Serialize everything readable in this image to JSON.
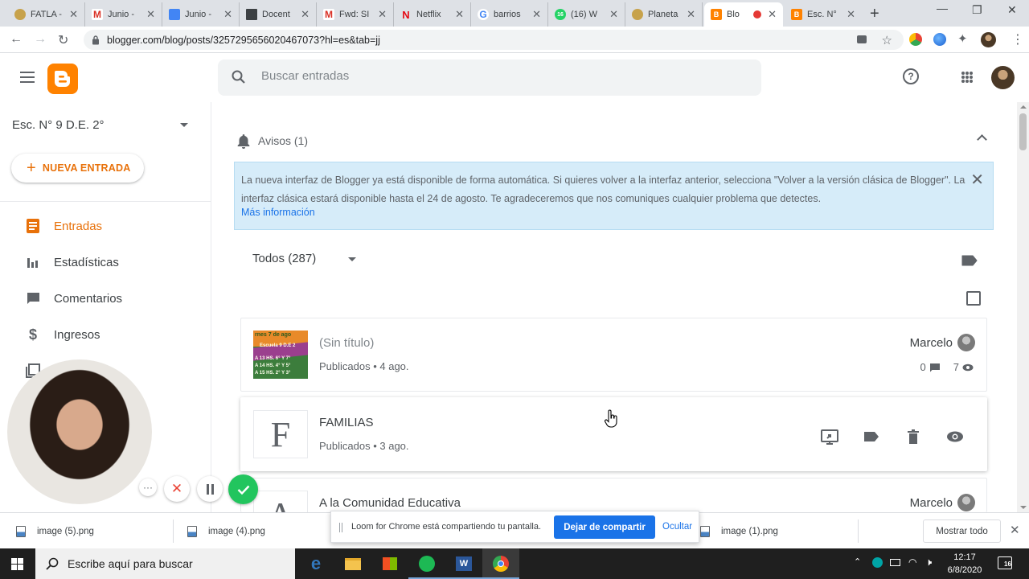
{
  "browser": {
    "tabs": [
      {
        "title": "FATLA -",
        "favicon": "fatla"
      },
      {
        "title": "Junio -",
        "favicon": "gmail"
      },
      {
        "title": "Junio -",
        "favicon": "docs"
      },
      {
        "title": "Docent",
        "favicon": "classroom"
      },
      {
        "title": "Fwd: SI",
        "favicon": "gmail"
      },
      {
        "title": "Netflix",
        "favicon": "netflix"
      },
      {
        "title": "barrios",
        "favicon": "google"
      },
      {
        "title": "(16) W",
        "favicon": "whatsapp"
      },
      {
        "title": "Planeta",
        "favicon": "fatla"
      },
      {
        "title": "Blo",
        "favicon": "blogger"
      },
      {
        "title": "Esc. N°",
        "favicon": "blogger"
      }
    ],
    "url": "blogger.com/blog/posts/3257295656020467073?hl=es&tab=jj"
  },
  "header": {
    "search_placeholder": "Buscar entradas"
  },
  "sidebar": {
    "blog_name": "Esc. N° 9 D.E. 2°",
    "new_post_label": "NUEVA ENTRADA",
    "items": [
      {
        "label": "Entradas",
        "icon": "posts-icon"
      },
      {
        "label": "Estadísticas",
        "icon": "stats-icon"
      },
      {
        "label": "Comentarios",
        "icon": "comments-icon"
      },
      {
        "label": "Ingresos",
        "icon": "earnings-icon"
      }
    ]
  },
  "notices": {
    "heading": "Avisos (1)",
    "message": "La nueva interfaz de Blogger ya está disponible de forma automática. Si quieres volver a la interfaz anterior, selecciona \"Volver a la versión clásica de Blogger\". La interfaz clásica estará disponible hasta el 24 de agosto. Te agradeceremos que nos comuniques cualquier problema que detectes.",
    "link": "Más información"
  },
  "posts": {
    "filter_label": "Todos (287)",
    "items": [
      {
        "title": "(Sin título)",
        "status": "Publicados • 4 ago.",
        "author": "Marcelo",
        "comments": "0",
        "views": "7",
        "thumb_text": [
          "rnes 7 de ago",
          "Escuela 9 D.E 2",
          "A 13 HS.  6° Y 7°",
          "A 14 HS.  4° Y 5°",
          "A 15 HS.  2° Y 3°"
        ]
      },
      {
        "title": "FAMILIAS",
        "status": "Publicados • 3 ago.",
        "letter": "F"
      },
      {
        "title": "A la Comunidad Educativa",
        "author": "Marcelo",
        "letter": "A"
      }
    ]
  },
  "loom": {
    "message": "Loom for Chrome está compartiendo tu pantalla.",
    "stop_label": "Dejar de compartir",
    "hide_label": "Ocultar"
  },
  "downloads": {
    "files": [
      "image (5).png",
      "image (4).png",
      "image (1).png"
    ],
    "show_all": "Mostrar todo"
  },
  "taskbar": {
    "search_placeholder": "Escribe aquí para buscar",
    "time": "12:17",
    "date": "6/8/2020",
    "notifications": "16"
  },
  "colors": {
    "accent": "#e8710a",
    "blogger": "#ff8200",
    "link": "#1a73e8",
    "notice_bg": "#d6ecf9"
  }
}
